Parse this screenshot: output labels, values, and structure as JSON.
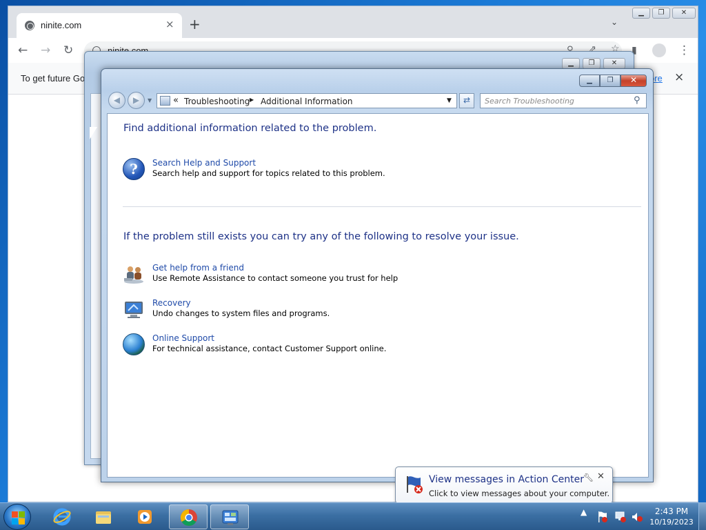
{
  "browser": {
    "tab_title": "ninite.com",
    "tab_close": "×",
    "new_tab": "+",
    "url": "ninite.com",
    "infobar_text": "To get future Go",
    "infobar_link": "ore",
    "infobar_close": "×"
  },
  "window": {
    "breadcrumb": {
      "chevron": "«",
      "items": [
        "Troubleshooting",
        "Additional Information"
      ]
    },
    "search_placeholder": "Search Troubleshooting",
    "heading_1": "Find additional information related to the problem.",
    "help_task": {
      "title": "Search Help and Support",
      "desc": "Search help and support for topics related to this problem."
    },
    "heading_2": "If the problem still exists you can try any of the following to resolve your issue.",
    "tasks": [
      {
        "title": "Get help from a friend",
        "desc": "Use Remote Assistance to contact someone you trust for help"
      },
      {
        "title": "Recovery",
        "desc": "Undo changes to system files and programs."
      },
      {
        "title": "Online Support",
        "desc": "For technical assistance, contact Customer Support online."
      }
    ]
  },
  "notification": {
    "title": "View messages in Action Center",
    "desc": "Click to view messages about your computer."
  },
  "taskbar": {
    "time": "2:43 PM",
    "date": "10/19/2023"
  }
}
